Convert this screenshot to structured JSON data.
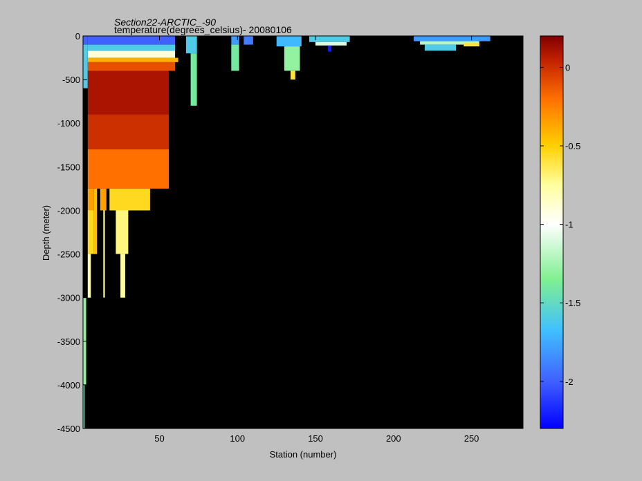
{
  "chart_data": {
    "type": "heatmap",
    "title": "Section22-ARCTIC_-90",
    "subtitle": "temperature(degrees_celsius)- 20080106",
    "xlabel": "Station (number)",
    "ylabel": "Depth (meter)",
    "xlim": [
      1,
      283
    ],
    "ylim": [
      -4500,
      0
    ],
    "x_ticks": [
      50,
      100,
      150,
      200,
      250
    ],
    "y_ticks": [
      0,
      -500,
      -1000,
      -1500,
      -2000,
      -2500,
      -3000,
      -3500,
      -4000,
      -4500
    ],
    "x_tick_labels": [
      "50",
      "100",
      "150",
      "200",
      "250"
    ],
    "y_tick_labels": [
      "0",
      "-500",
      "-1000",
      "-1500",
      "-2000",
      "-2500",
      "-3000",
      "-3500",
      "-4000",
      "-4500"
    ],
    "colorbar": {
      "colormap": "jet",
      "range": [
        -2.3,
        0.2
      ],
      "ticks": [
        0,
        -0.5,
        -1,
        -1.5,
        -2
      ],
      "tick_labels": [
        "0",
        "-0.5",
        "-1",
        "-1.5",
        "-2"
      ]
    },
    "nodata_color": "#000000",
    "cells": [
      {
        "x": [
          1,
          4
        ],
        "depth": [
          0,
          100
        ],
        "value": -2.0
      },
      {
        "x": [
          4,
          60
        ],
        "depth": [
          0,
          100
        ],
        "value": -2.0
      },
      {
        "x": [
          4,
          60
        ],
        "depth": [
          100,
          170
        ],
        "value": -1.6
      },
      {
        "x": [
          4,
          60
        ],
        "depth": [
          170,
          250
        ],
        "value": -0.9
      },
      {
        "x": [
          4,
          62
        ],
        "depth": [
          250,
          300
        ],
        "value": -0.4
      },
      {
        "x": [
          1,
          4
        ],
        "depth": [
          100,
          600
        ],
        "value": -1.6
      },
      {
        "x": [
          4,
          60
        ],
        "depth": [
          300,
          400
        ],
        "value": -0.1
      },
      {
        "x": [
          4,
          56
        ],
        "depth": [
          400,
          900
        ],
        "value": 0.1
      },
      {
        "x": [
          4,
          56
        ],
        "depth": [
          900,
          1300
        ],
        "value": 0.0
      },
      {
        "x": [
          4,
          56
        ],
        "depth": [
          1300,
          1750
        ],
        "value": -0.2
      },
      {
        "x": [
          4,
          8
        ],
        "depth": [
          1750,
          2000
        ],
        "value": -0.35
      },
      {
        "x": [
          8,
          10
        ],
        "depth": [
          1750,
          2500
        ],
        "value": -0.45
      },
      {
        "x": [
          12,
          16
        ],
        "depth": [
          1750,
          2000
        ],
        "value": -0.35
      },
      {
        "x": [
          18,
          44
        ],
        "depth": [
          1750,
          2000
        ],
        "value": -0.55
      },
      {
        "x": [
          4,
          8
        ],
        "depth": [
          2000,
          2500
        ],
        "value": -0.55
      },
      {
        "x": [
          4,
          6
        ],
        "depth": [
          2500,
          3000
        ],
        "value": -0.8
      },
      {
        "x": [
          14,
          15
        ],
        "depth": [
          2000,
          3000
        ],
        "value": -0.7
      },
      {
        "x": [
          22,
          30
        ],
        "depth": [
          2000,
          2500
        ],
        "value": -0.7
      },
      {
        "x": [
          25,
          28
        ],
        "depth": [
          2500,
          3000
        ],
        "value": -0.75
      },
      {
        "x": [
          1,
          3
        ],
        "depth": [
          3000,
          4000
        ],
        "value": -1.3
      },
      {
        "x": [
          1,
          2
        ],
        "depth": [
          4000,
          4500
        ],
        "value": -1.45
      },
      {
        "x": [
          67,
          74
        ],
        "depth": [
          0,
          200
        ],
        "value": -1.6
      },
      {
        "x": [
          70,
          74
        ],
        "depth": [
          200,
          800
        ],
        "value": -1.4
      },
      {
        "x": [
          96,
          101
        ],
        "depth": [
          0,
          100
        ],
        "value": -1.8
      },
      {
        "x": [
          96,
          101
        ],
        "depth": [
          100,
          400
        ],
        "value": -1.4
      },
      {
        "x": [
          104,
          110
        ],
        "depth": [
          0,
          100
        ],
        "value": -1.9
      },
      {
        "x": [
          125,
          141
        ],
        "depth": [
          0,
          120
        ],
        "value": -1.7
      },
      {
        "x": [
          130,
          140
        ],
        "depth": [
          120,
          400
        ],
        "value": -1.3
      },
      {
        "x": [
          134,
          137
        ],
        "depth": [
          400,
          500
        ],
        "value": -0.6
      },
      {
        "x": [
          146,
          172
        ],
        "depth": [
          0,
          70
        ],
        "value": -1.6
      },
      {
        "x": [
          150,
          170
        ],
        "depth": [
          70,
          110
        ],
        "value": -1.1
      },
      {
        "x": [
          158,
          160
        ],
        "depth": [
          110,
          180
        ],
        "value": -2.2
      },
      {
        "x": [
          213,
          262
        ],
        "depth": [
          0,
          60
        ],
        "value": -1.8
      },
      {
        "x": [
          217,
          255
        ],
        "depth": [
          60,
          100
        ],
        "value": -1.2
      },
      {
        "x": [
          220,
          240
        ],
        "depth": [
          100,
          170
        ],
        "value": -1.6
      },
      {
        "x": [
          245,
          255
        ],
        "depth": [
          80,
          120
        ],
        "value": -0.6
      }
    ]
  }
}
